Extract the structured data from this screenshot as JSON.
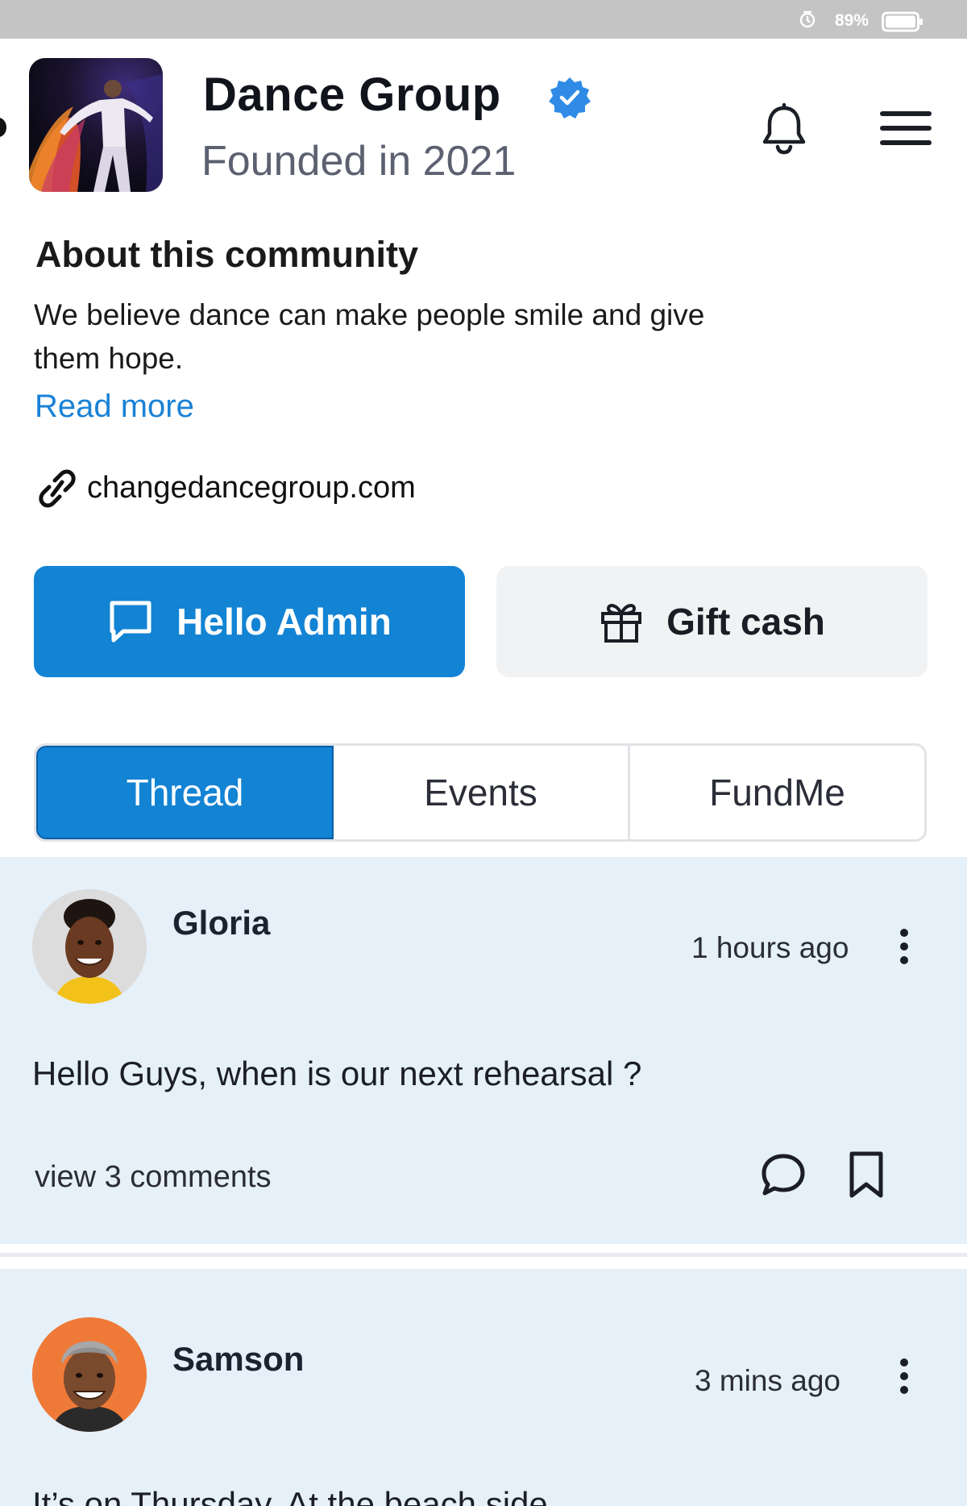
{
  "status_bar": {
    "battery_percent": "89%",
    "icons": [
      "alarm-icon",
      "battery-icon"
    ]
  },
  "group": {
    "title": "Dance Group",
    "subtitle": "Founded in 2021",
    "verified": true,
    "icons": [
      "verified-badge-icon",
      "bell-icon",
      "hamburger-menu-icon"
    ]
  },
  "about": {
    "heading": "About this community",
    "text": "We believe dance can make people smile and give them hope.",
    "read_more": "Read more",
    "website": "changedancegroup.com"
  },
  "actions": {
    "primary_label": "Hello Admin",
    "secondary_label": "Gift cash"
  },
  "tabs": [
    {
      "label": "Thread",
      "active": true
    },
    {
      "label": "Events",
      "active": false
    },
    {
      "label": "FundMe",
      "active": false
    }
  ],
  "posts": [
    {
      "author": "Gloria",
      "time": "1 hours ago",
      "text": "Hello Guys, when is our next rehearsal ?",
      "comments_label": "view 3 comments"
    },
    {
      "author": "Samson",
      "time": "3 mins ago",
      "text": "It’s on Thursday. At the beach side."
    }
  ],
  "colors": {
    "accent": "#1383d4",
    "link": "#1a82d6",
    "post_background": "#e6f0f9",
    "verified_badge": "#2f8be6"
  }
}
